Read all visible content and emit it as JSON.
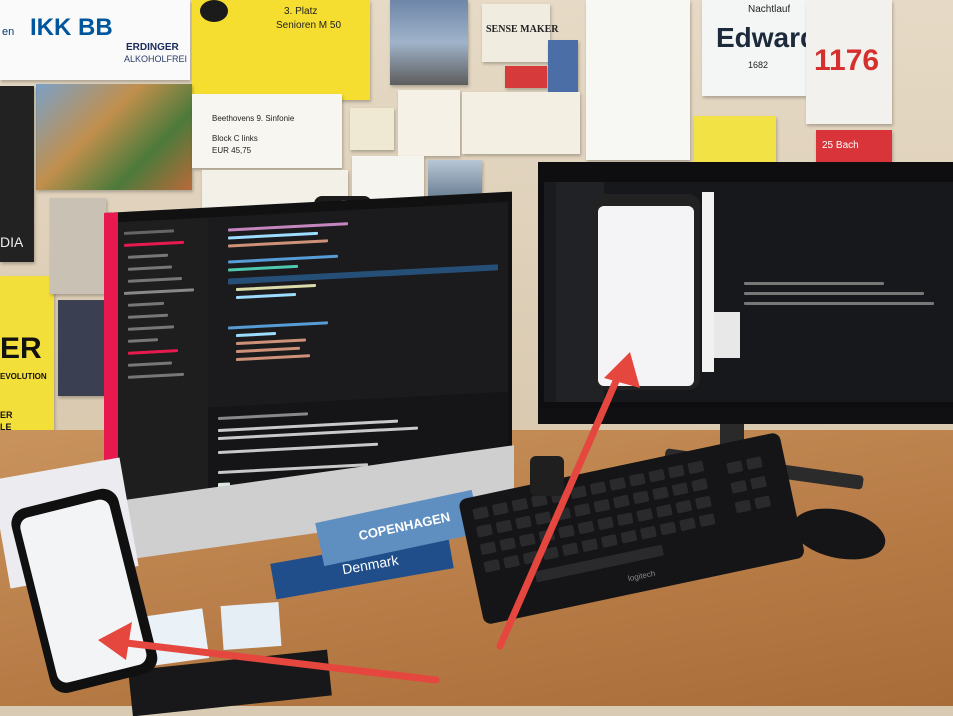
{
  "wall_notes": {
    "ikk_logo": "IKK BB",
    "ikk_left": "en",
    "erdinger": "ERDINGER",
    "erdinger_sub": "ALKOHOLFREI",
    "yellow_card_line1": "3. Platz",
    "yellow_card_line2": "Senioren M 50",
    "sense_maker": "SENSE MAKER",
    "ticket_title": "Beethovens 9. Sinfonie",
    "ticket_block": "Block C links",
    "ticket_price": "EUR  45,75",
    "bib_label": "Nachtlauf",
    "bib_name": "Edward",
    "bib_number": "1682",
    "race_number": "1176",
    "sticker": "25 Bach",
    "poster_left_partial": "DIA",
    "yellow_poster_partial": "ER",
    "yellow_poster_sub": "EVOLUTION",
    "yellow_poster_sub2": "ER",
    "yellow_poster_sub3": "LE"
  },
  "books": {
    "book_top": "COPENHAGEN",
    "book_bottom": "Denmark"
  },
  "keyboard": {
    "brand": "logitech"
  },
  "colors": {
    "editor_accent": "#e8194f",
    "arrow": "#e5473f",
    "desk": "#b67a45",
    "wall": "#e2d5bf"
  }
}
